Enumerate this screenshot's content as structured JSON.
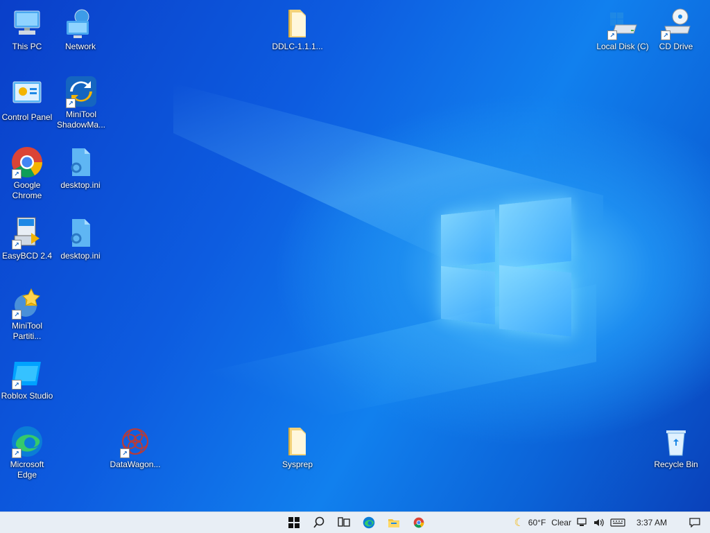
{
  "desktop": {
    "icons": [
      {
        "id": "this-pc",
        "label": "This PC"
      },
      {
        "id": "network",
        "label": "Network"
      },
      {
        "id": "ddlc",
        "label": "DDLC-1.1.1..."
      },
      {
        "id": "local-disk",
        "label": "Local Disk (C)"
      },
      {
        "id": "cd-drive",
        "label": "CD Drive"
      },
      {
        "id": "control-panel",
        "label": "Control Panel"
      },
      {
        "id": "minitool-shadowmaker",
        "label": "MiniTool ShadowMa..."
      },
      {
        "id": "google-chrome",
        "label": "Google Chrome"
      },
      {
        "id": "desktop-ini-1",
        "label": "desktop.ini"
      },
      {
        "id": "easybcd",
        "label": "EasyBCD 2.4"
      },
      {
        "id": "desktop-ini-2",
        "label": "desktop.ini"
      },
      {
        "id": "minitool-partition",
        "label": "MiniTool Partiti..."
      },
      {
        "id": "roblox-studio",
        "label": "Roblox Studio"
      },
      {
        "id": "microsoft-edge",
        "label": "Microsoft Edge"
      },
      {
        "id": "datawagon",
        "label": "DataWagon..."
      },
      {
        "id": "sysprep",
        "label": "Sysprep"
      },
      {
        "id": "recycle-bin",
        "label": "Recycle Bin"
      }
    ]
  },
  "taskbar": {
    "apps": [
      "start-icon",
      "search-icon",
      "task-view-icon",
      "edge-icon",
      "file-explorer-icon",
      "chrome-icon"
    ],
    "weather": {
      "temp": "60°F",
      "condition": "Clear"
    },
    "clock": "3:37 AM"
  },
  "colors": {
    "accent": "#0078d4",
    "taskbar": "#e8eef5"
  }
}
